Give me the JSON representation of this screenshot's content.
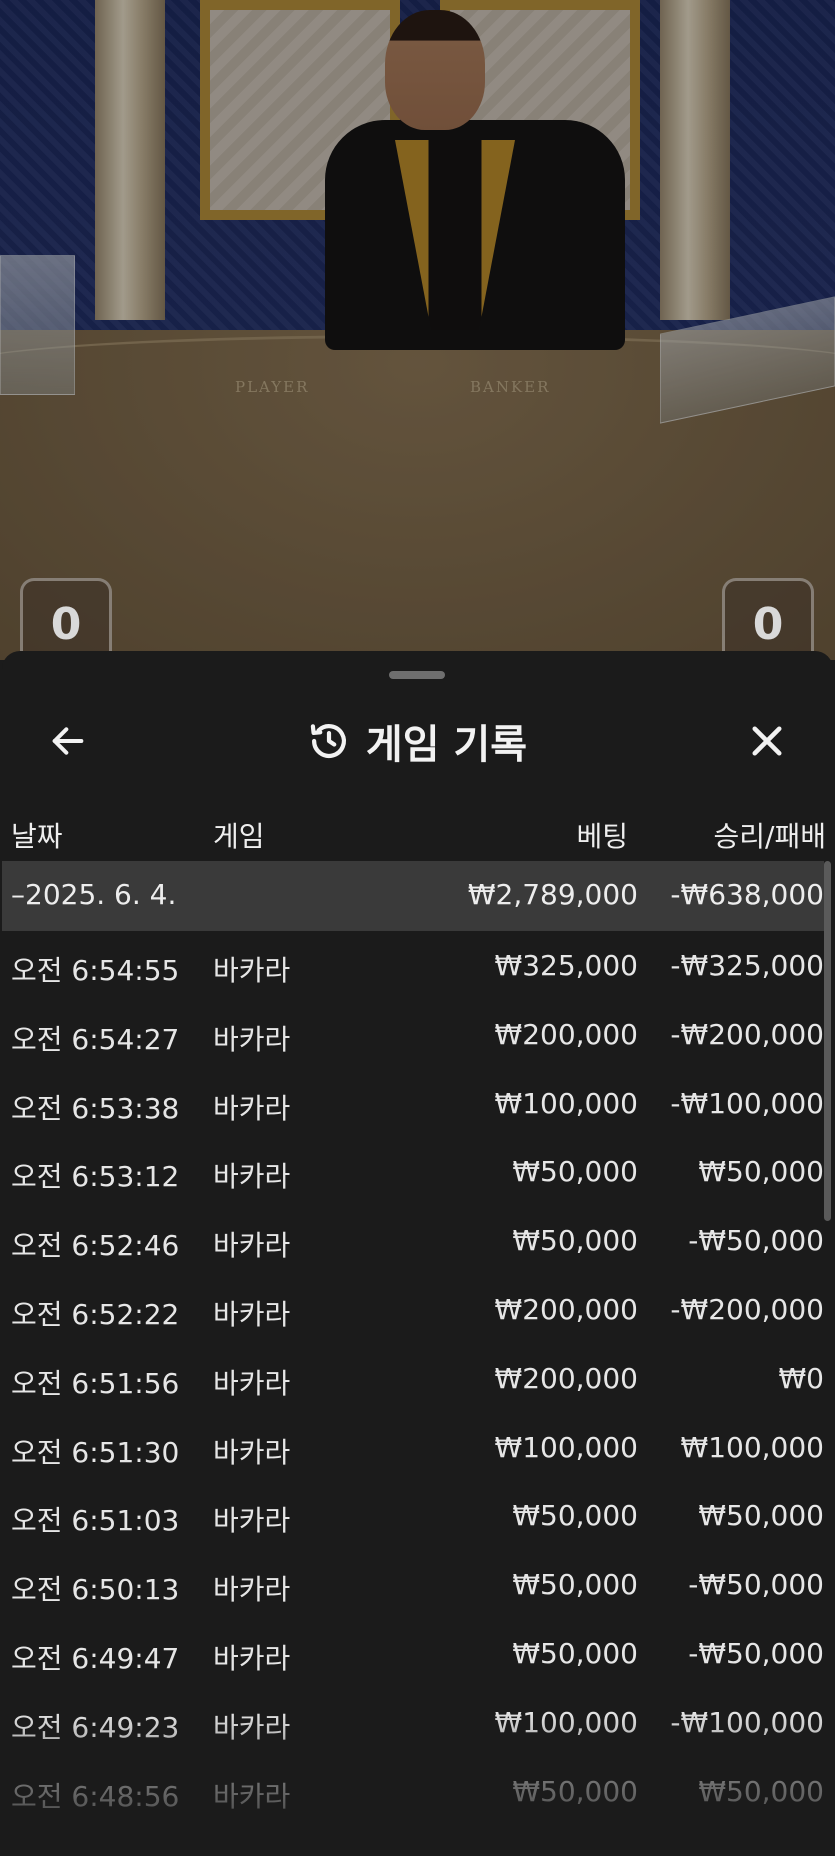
{
  "video": {
    "felt_player_label": "PLAYER",
    "felt_banker_label": "BANKER",
    "player_score": "0",
    "banker_score": "0"
  },
  "header": {
    "title": "게임 기록",
    "back_icon": "arrow-left-icon",
    "history_icon": "history-icon",
    "close_icon": "close-icon"
  },
  "columns": {
    "date": "날짜",
    "game": "게임",
    "bet": "베팅",
    "win_loss": "승리/패배"
  },
  "day_summary": {
    "date": "–2025. 6. 4.",
    "bet": "₩2,789,000",
    "win_loss": "-₩638,000"
  },
  "rows": [
    {
      "time": "오전 6:54:55",
      "game": "바카라",
      "bet": "₩325,000",
      "win_loss": "-₩325,000"
    },
    {
      "time": "오전 6:54:27",
      "game": "바카라",
      "bet": "₩200,000",
      "win_loss": "-₩200,000"
    },
    {
      "time": "오전 6:53:38",
      "game": "바카라",
      "bet": "₩100,000",
      "win_loss": "-₩100,000"
    },
    {
      "time": "오전 6:53:12",
      "game": "바카라",
      "bet": "₩50,000",
      "win_loss": "₩50,000"
    },
    {
      "time": "오전 6:52:46",
      "game": "바카라",
      "bet": "₩50,000",
      "win_loss": "-₩50,000"
    },
    {
      "time": "오전 6:52:22",
      "game": "바카라",
      "bet": "₩200,000",
      "win_loss": "-₩200,000"
    },
    {
      "time": "오전 6:51:56",
      "game": "바카라",
      "bet": "₩200,000",
      "win_loss": "₩0"
    },
    {
      "time": "오전 6:51:30",
      "game": "바카라",
      "bet": "₩100,000",
      "win_loss": "₩100,000"
    },
    {
      "time": "오전 6:51:03",
      "game": "바카라",
      "bet": "₩50,000",
      "win_loss": "₩50,000"
    },
    {
      "time": "오전 6:50:13",
      "game": "바카라",
      "bet": "₩50,000",
      "win_loss": "-₩50,000"
    },
    {
      "time": "오전 6:49:47",
      "game": "바카라",
      "bet": "₩50,000",
      "win_loss": "-₩50,000"
    },
    {
      "time": "오전 6:49:23",
      "game": "바카라",
      "bet": "₩100,000",
      "win_loss": "-₩100,000"
    },
    {
      "time": "오전 6:48:56",
      "game": "바카라",
      "bet": "₩50,000",
      "win_loss": "₩50,000"
    }
  ]
}
